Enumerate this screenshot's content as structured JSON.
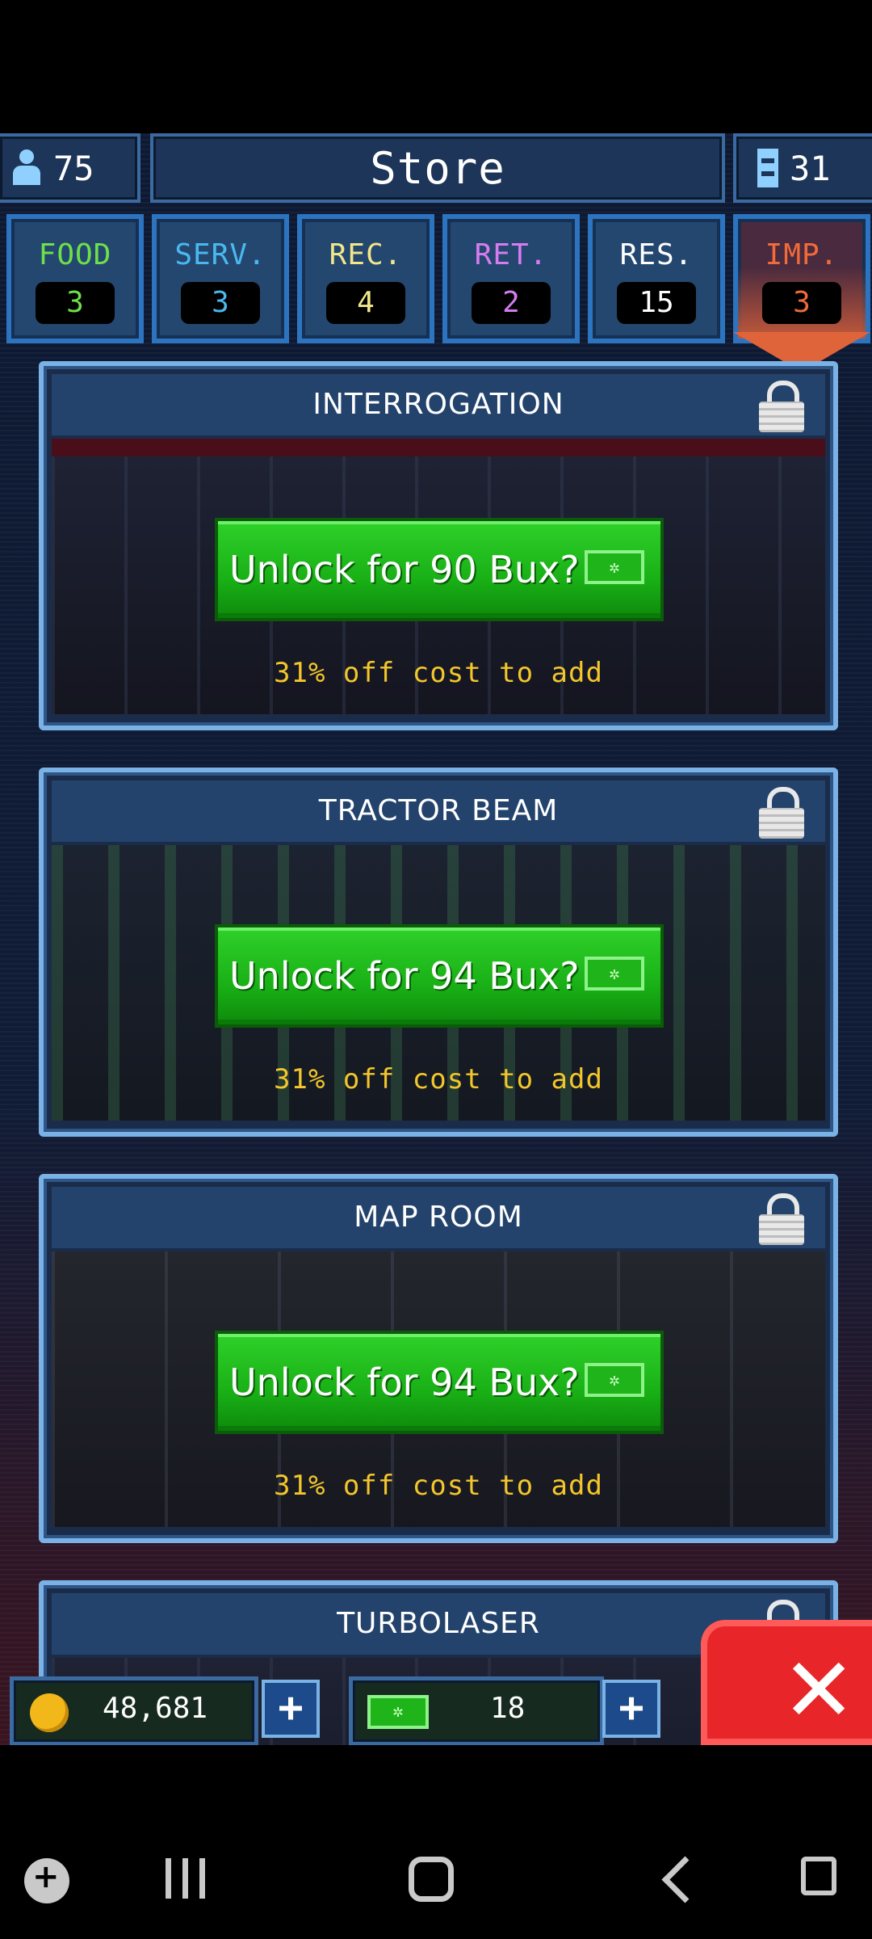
{
  "header": {
    "population": "75",
    "title": "Store",
    "floors": "31"
  },
  "tabs": [
    {
      "label": "FOOD",
      "count": "3",
      "color": "#6ee04a"
    },
    {
      "label": "SERV.",
      "count": "3",
      "color": "#4ab8f0"
    },
    {
      "label": "REC.",
      "count": "4",
      "color": "#f0e68a"
    },
    {
      "label": "RET.",
      "count": "2",
      "color": "#d67cf0"
    },
    {
      "label": "RES.",
      "count": "15",
      "color": "#ffffff"
    },
    {
      "label": "IMP.",
      "count": "3",
      "color": "#f06a3a"
    }
  ],
  "cards": [
    {
      "title": "INTERROGATION",
      "button": "Unlock for 90 Bux?",
      "discount": "31% off cost to add"
    },
    {
      "title": "TRACTOR BEAM",
      "button": "Unlock for 94 Bux?",
      "discount": "31% off cost to add"
    },
    {
      "title": "MAP ROOM",
      "button": "Unlock for 94 Bux?",
      "discount": "31% off cost to add"
    },
    {
      "title": "TURBOLASER"
    }
  ],
  "currency": {
    "coins": "48,681",
    "bux": "18",
    "plus": "+",
    "bux_glyph": "✲"
  },
  "close": {
    "glyph": "✕"
  },
  "colors": {
    "accent_green": "#19b016",
    "gold": "#f3c62c",
    "close_red": "#e8262a",
    "frame_blue": "#7ab2e6"
  },
  "icons": [
    "person-icon",
    "floor-icon",
    "lock-icon",
    "bux-icon",
    "coin-icon",
    "plus-icon",
    "close-icon",
    "game-pad-icon",
    "recents-icon",
    "home-icon",
    "back-icon",
    "keyboard-icon"
  ]
}
